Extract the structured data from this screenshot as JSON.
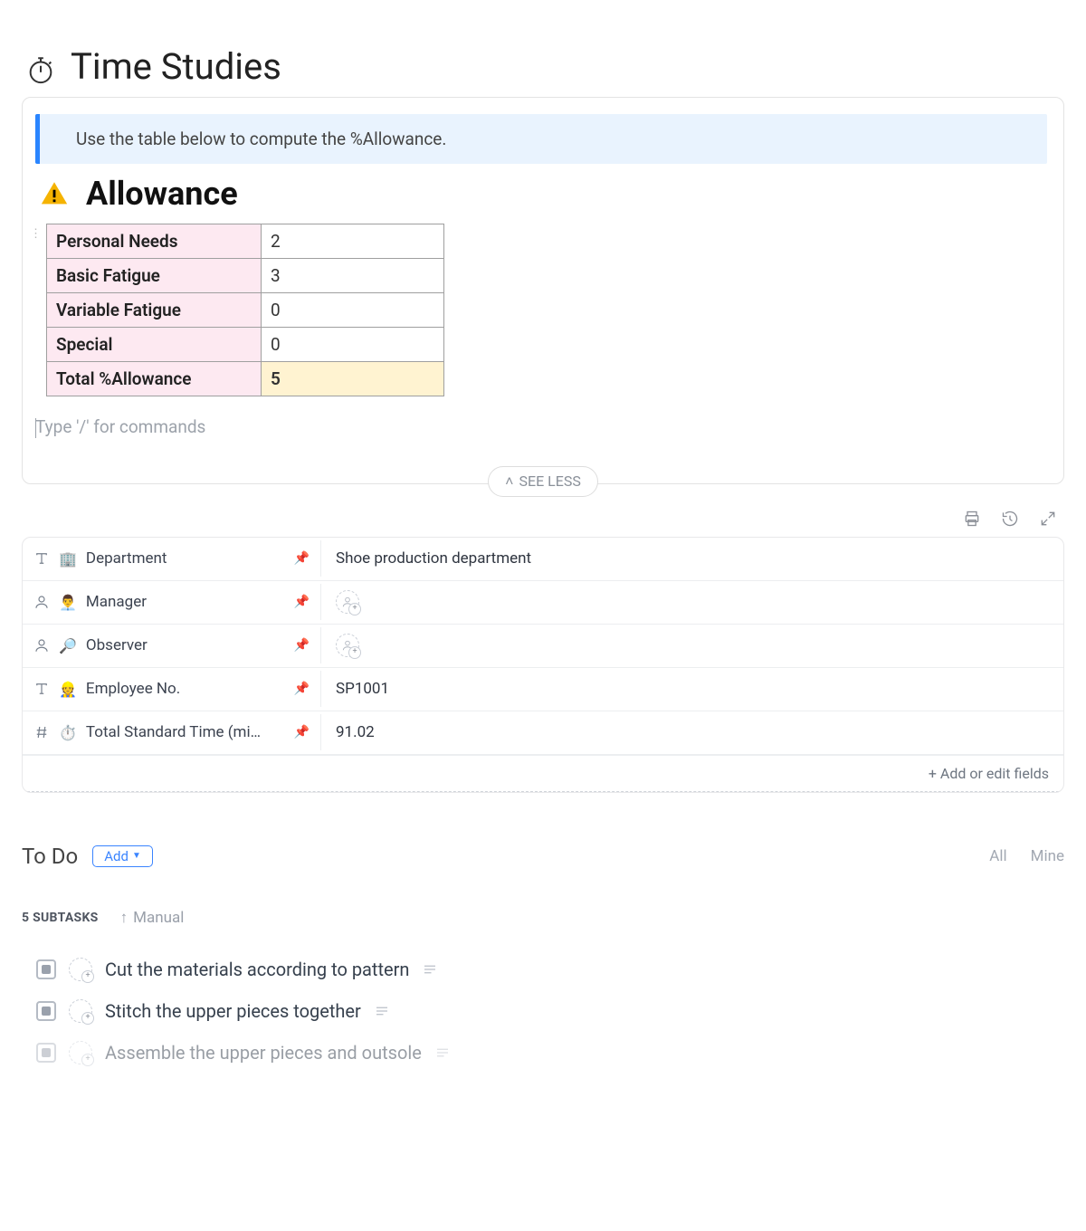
{
  "page": {
    "title": "Time Studies"
  },
  "banner": {
    "text": "Use the table below to compute the %Allowance."
  },
  "allowance": {
    "heading": "Allowance",
    "rows": [
      {
        "label": "Personal Needs",
        "value": "2"
      },
      {
        "label": "Basic Fatigue",
        "value": "3"
      },
      {
        "label": "Variable Fatigue",
        "value": "0"
      },
      {
        "label": "Special",
        "value": "0"
      }
    ],
    "total": {
      "label": "Total %Allowance",
      "value": "5"
    }
  },
  "command": {
    "placeholder": "Type '/' for commands"
  },
  "seeless": {
    "label": "SEE LESS"
  },
  "fields": {
    "rows": {
      "department": {
        "label": "Department",
        "value": "Shoe production department"
      },
      "manager": {
        "label": "Manager",
        "value": ""
      },
      "observer": {
        "label": "Observer",
        "value": ""
      },
      "employee": {
        "label": "Employee No.",
        "value": "SP1001"
      },
      "tst": {
        "label": "Total Standard Time (mi…",
        "value": "91.02"
      }
    },
    "add_label": "+ Add or edit fields"
  },
  "todo": {
    "title": "To Do",
    "add_label": "Add",
    "filters": {
      "all": "All",
      "mine": "Mine"
    },
    "subtasks_count": "5 SUBTASKS",
    "sort_label": "Manual",
    "tasks": [
      {
        "title": "Cut the materials according to pattern"
      },
      {
        "title": "Stitch the upper pieces together"
      },
      {
        "title": "Assemble the upper pieces and outsole"
      }
    ]
  }
}
